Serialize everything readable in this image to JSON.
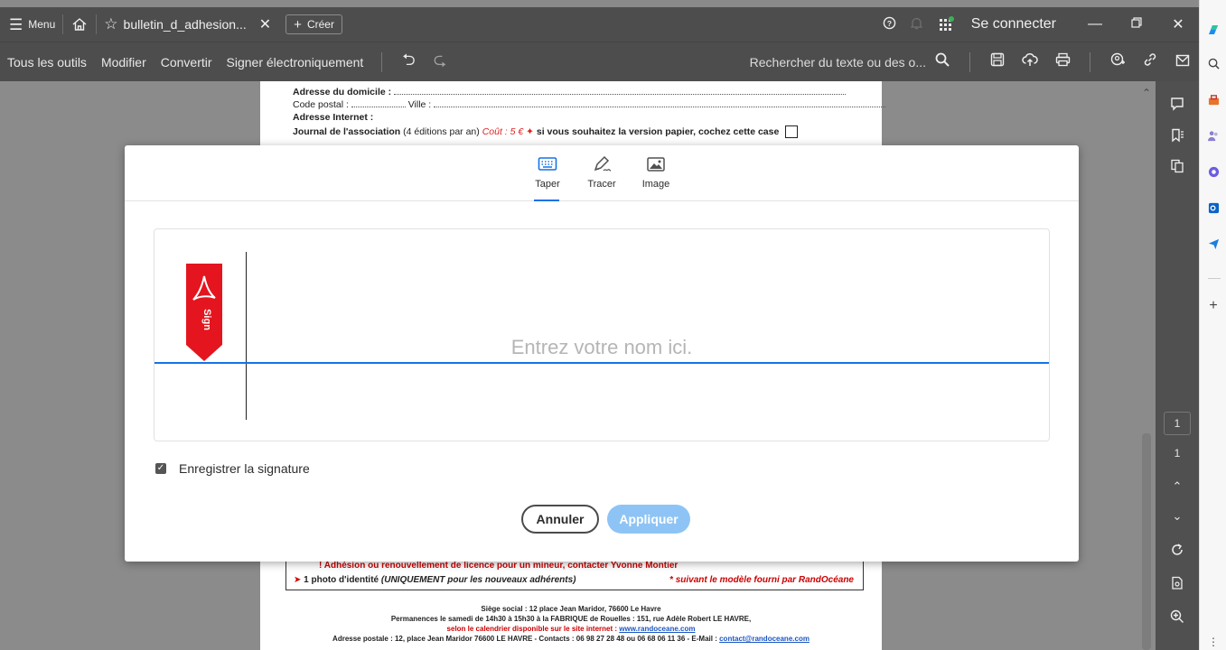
{
  "titlebar": {
    "menu_label": "Menu",
    "tab_title": "bulletin_d_adhesion...",
    "create_label": "Créer",
    "signin_label": "Se connecter"
  },
  "toolbar": {
    "items": [
      "Tous les outils",
      "Modifier",
      "Convertir",
      "Signer électroniquement"
    ],
    "search_text": "Rechercher du texte ou des o..."
  },
  "document": {
    "address_label": "Adresse du domicile :",
    "postal_label": "Code postal :",
    "city_label": "Ville :",
    "internet_label": "Adresse Internet :",
    "journal_label": "Journal de l'association",
    "journal_editions": "(4 éditions par an)",
    "journal_cost": "Coût : 5 €",
    "journal_version": "si vous souhaitez la version papier, cochez cette case",
    "minor_note": "Adhésion ou renouvellement de licence pour un mineur, contacter Yvonne Montier",
    "photo_note": "1 photo d'identité",
    "photo_note_italic": "(UNIQUEMENT pour les nouveaux adhérents)",
    "model_note": "* suivant le modèle fourni par RandOcéane",
    "footer_1": "Siège social : 12 place Jean Maridor, 76600 Le Havre",
    "footer_2": "Permanences le samedi de 14h30 à 15h30 à la FABRIQUE de Rouelles : 151, rue Adèle Robert LE HAVRE,",
    "footer_3_prefix": "selon le calendrier disponible sur le site internet :",
    "footer_3_link": "www.randoceane.com",
    "footer_4_prefix": "Adresse postale : 12, place Jean Maridor 76600 LE HAVRE - Contacts : 06 98 27 28 48 ou 06 68 06 11 36 - E-Mail :",
    "footer_4_link": "contact@randoceane.com"
  },
  "right_panel": {
    "page_current": "1",
    "page_total": "1"
  },
  "modal": {
    "tabs": [
      {
        "label": "Taper",
        "icon": "keyboard-icon",
        "active": true
      },
      {
        "label": "Tracer",
        "icon": "pen-draw-icon",
        "active": false
      },
      {
        "label": "Image",
        "icon": "image-icon",
        "active": false
      }
    ],
    "sign_flag_text": "Sign",
    "name_placeholder": "Entrez votre nom ici.",
    "save_signature_label": "Enregistrer la signature",
    "save_signature_checked": true,
    "cancel_label": "Annuler",
    "apply_label": "Appliquer"
  },
  "colors": {
    "accent": "#1473e6",
    "apply_disabled": "#8ec4f5",
    "adobe_red": "#e4151e",
    "chrome_dark": "#4d4d4d"
  }
}
